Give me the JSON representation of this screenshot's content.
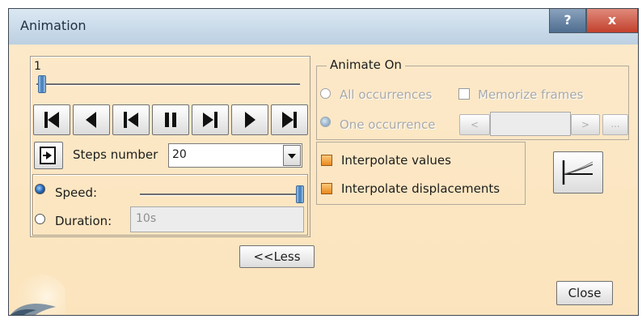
{
  "window": {
    "title": "Animation",
    "help_label": "?",
    "close_label": "x"
  },
  "player": {
    "frame_value": "1",
    "frame_position": 0,
    "buttons": [
      "first-frame",
      "step-back",
      "play-backward",
      "pause",
      "play-forward",
      "step-forward",
      "last-frame"
    ]
  },
  "steps": {
    "label": "Steps number",
    "value": "20"
  },
  "timing": {
    "speed_label": "Speed:",
    "speed_position": 1,
    "speed_selected": true,
    "duration_label": "Duration:",
    "duration_value": "10s"
  },
  "less_button": "<<Less",
  "animate_on": {
    "title": "Animate On",
    "all_occurrences": "All occurrences",
    "memorize_frames": "Memorize frames",
    "one_occurrence": "One occurrence",
    "prev_label": "<",
    "next_label": ">",
    "more_label": "..."
  },
  "options": {
    "interpolate_values": "Interpolate values",
    "interpolate_displacements": "Interpolate displacements"
  },
  "close_button": "Close",
  "colors": {
    "background": "#fbe7c3",
    "accent": "#1f5fb0",
    "check": "#e8891e"
  }
}
